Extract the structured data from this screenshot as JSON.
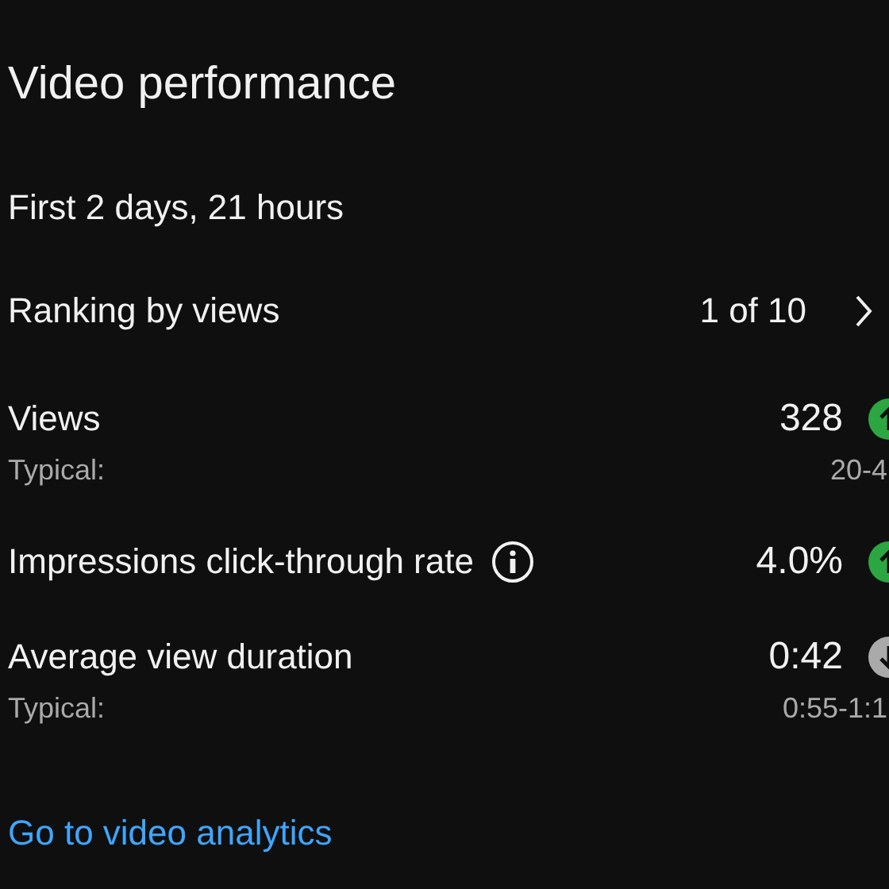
{
  "title": "Video performance",
  "period": "First 2 days, 21 hours",
  "ranking": {
    "label": "Ranking by views",
    "value": "1 of 10"
  },
  "metrics": [
    {
      "label": "Views",
      "info": false,
      "value": "328",
      "rising": true,
      "typical_label": "Typical:",
      "typical": "20-4"
    },
    {
      "label": "Impressions click-through rate",
      "info": true,
      "value": "4.0%",
      "rising": true
    },
    {
      "label": "Average view duration",
      "info": false,
      "value": "0:42",
      "rising": false,
      "typical_label": "Typical:",
      "typical": "0:55-1:1"
    }
  ],
  "link": "Go to video analytics"
}
